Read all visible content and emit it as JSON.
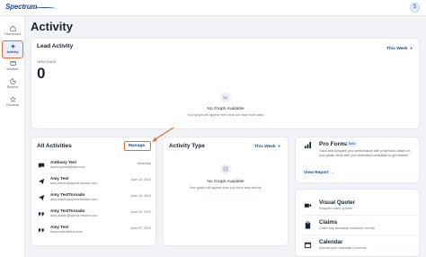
{
  "brand": {
    "logo_text": "Spectrum",
    "accent": "#1a4fa3",
    "highlight": "#f06a2a"
  },
  "user": {
    "initial": "S"
  },
  "sidebar": {
    "items": [
      {
        "label": "Dashboard",
        "icon": "home-icon",
        "active": false
      },
      {
        "label": "Activity",
        "icon": "activity-icon",
        "active": true
      },
      {
        "label": "Website",
        "icon": "browser-icon",
        "active": false
      },
      {
        "label": "Reports",
        "icon": "reports-icon",
        "active": false
      },
      {
        "label": "Reviews",
        "icon": "star-icon",
        "active": false
      }
    ]
  },
  "page": {
    "title": "Activity"
  },
  "lead_activity": {
    "title": "Lead Activity",
    "period": "This Week",
    "metric_label": "NEW LEADS",
    "metric_value": "0",
    "empty_title": "No Graph Available",
    "empty_subtitle": "Your graph will appear here once we have more data."
  },
  "all_activities": {
    "title": "All Activities",
    "manage_label": "Manage",
    "rows": [
      {
        "icon": "chat-icon",
        "name": "Anthony Test",
        "email": "anthony.test@test.com",
        "date": "Yesterday"
      },
      {
        "icon": "send-icon",
        "name": "Amy Test",
        "email": "amy.martin@spectrumone.com",
        "date": "June 10, 2024"
      },
      {
        "icon": "send-icon",
        "name": "Amy TestTornado",
        "email": "amy.martin@spectrumone.com",
        "date": "June 10, 2024"
      },
      {
        "icon": "quote-icon",
        "name": "Amy TestTornado",
        "email": "amy.martin@spectrumone.com",
        "date": "June 10, 2024"
      },
      {
        "icon": "quote-icon",
        "name": "Amy Test",
        "email": "amymartin@test.com",
        "date": "June 07, 2024"
      }
    ]
  },
  "activity_type": {
    "title": "Activity Type",
    "period": "This Week",
    "empty_title": "No Graph Available",
    "empty_subtitle": "Your graph will appear once you have lead activity."
  },
  "pro_forma": {
    "title": "Pro Forma",
    "badge": "Beta",
    "description": "Track and compare your performance with projections based on your goals. Work with your dedicated consultant to get started!",
    "link_label": "View Report"
  },
  "tools": [
    {
      "icon": "video-icon",
      "title": "Visual Quoter",
      "subtitle": "Request video quotes"
    },
    {
      "icon": "clipboard-icon",
      "title": "Claims",
      "subtitle": "Claim any available customer events"
    },
    {
      "icon": "calendar-icon",
      "title": "Calendar",
      "subtitle": "Access your calendar of events"
    }
  ]
}
